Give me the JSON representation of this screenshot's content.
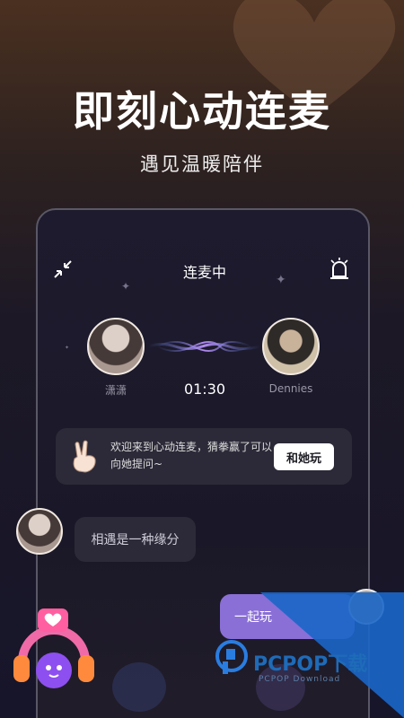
{
  "hero": {
    "title": "即刻心动连麦",
    "subtitle": "遇见温暖陪伴"
  },
  "call": {
    "header_title": "连麦中",
    "left_user": "潇潇",
    "right_user": "Dennies",
    "timer": "01:30"
  },
  "notice": {
    "text": "欢迎来到心动连麦，猜拳赢了可以向她提问~",
    "button_label": "和她玩"
  },
  "chat": {
    "message_1": "相遇是一种缘分",
    "message_2": "一起玩"
  },
  "watermark": {
    "brand": "PCPOP下载",
    "sub": "PCPOP Download"
  },
  "colors": {
    "accent_purple": "#8a6fd6",
    "bubble": "#2c2a38"
  }
}
